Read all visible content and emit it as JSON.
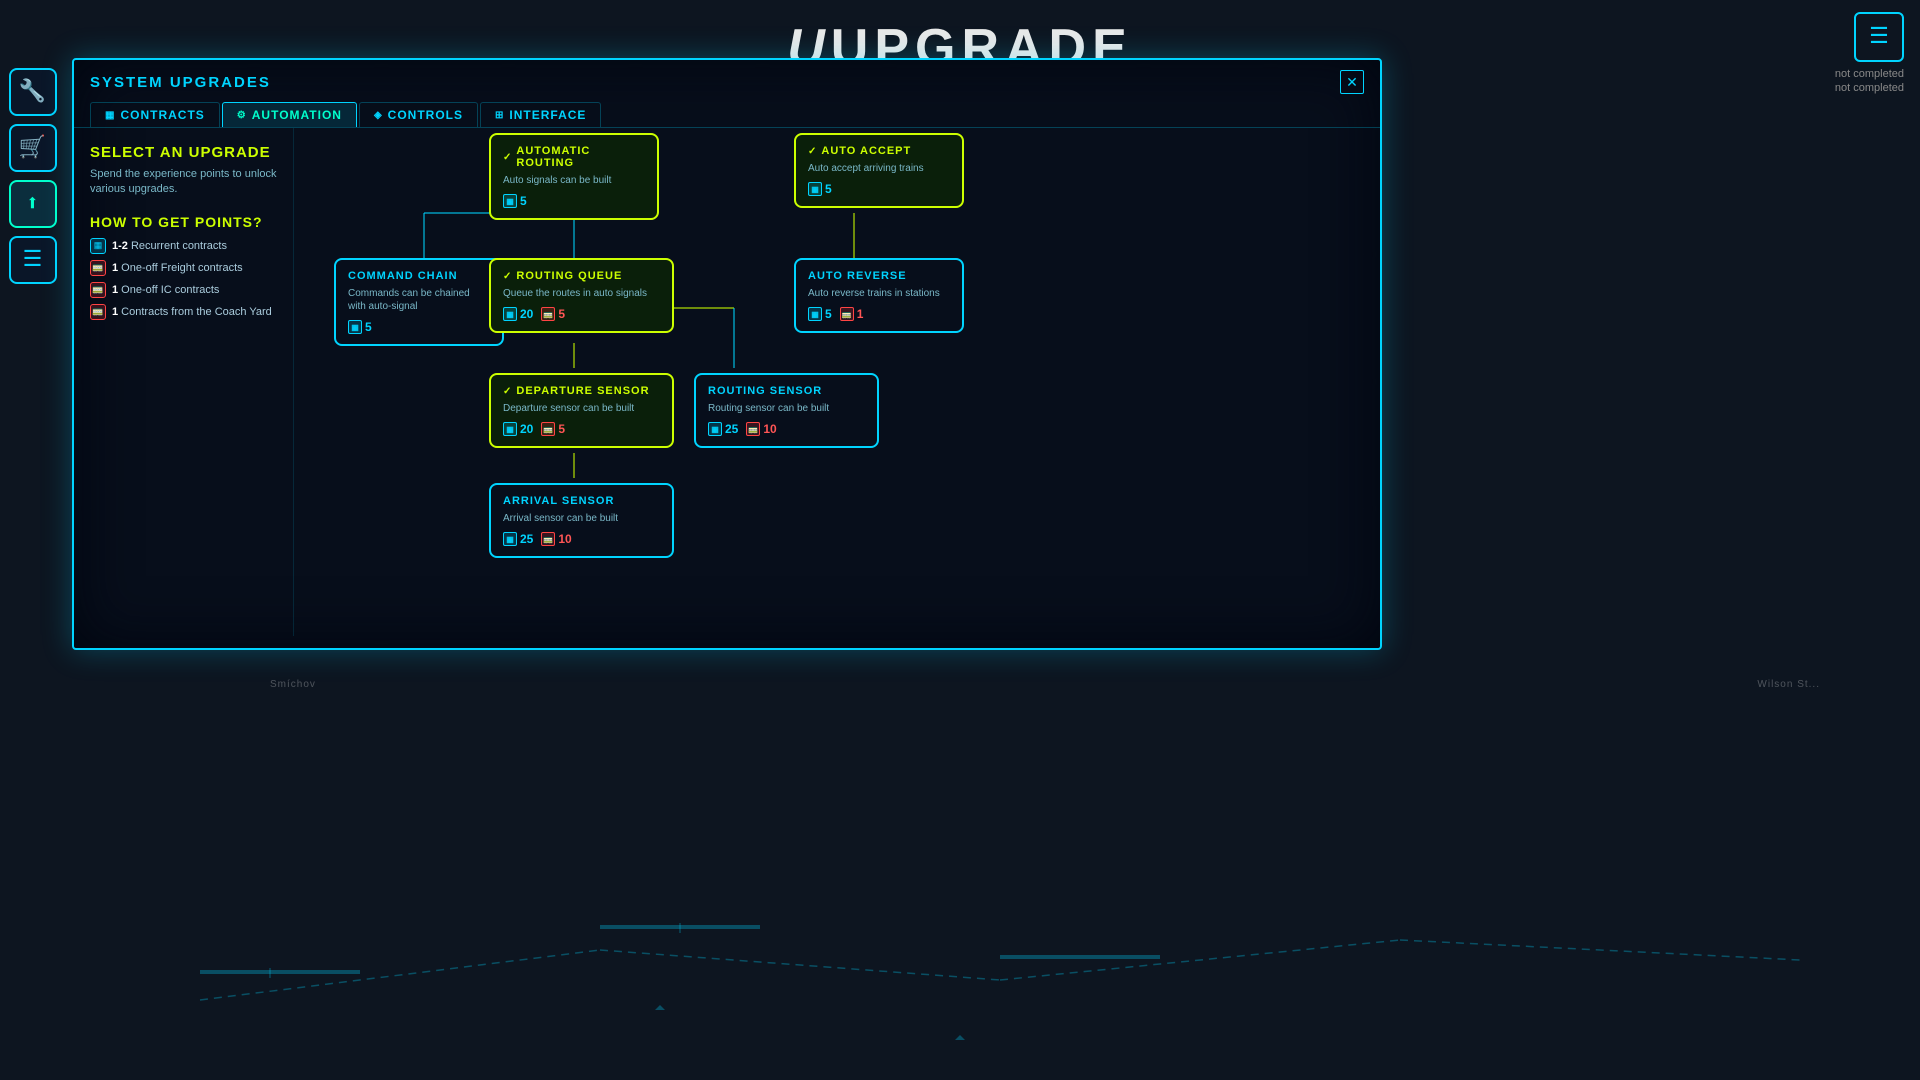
{
  "page": {
    "title": "Upgrade",
    "status1": "not completed",
    "status2": "not completed"
  },
  "sidebar": {
    "buttons": [
      {
        "id": "wrench",
        "icon": "🔧",
        "active": false
      },
      {
        "id": "cart",
        "icon": "🛒",
        "active": false
      },
      {
        "id": "upgrade",
        "icon": "⬆",
        "active": true
      },
      {
        "id": "list",
        "icon": "☰",
        "active": false
      }
    ]
  },
  "dialog": {
    "title": "System Upgrades",
    "close_label": "✕",
    "tabs": [
      {
        "id": "contracts",
        "label": "CONTRACTS",
        "icon": "▦",
        "active": false
      },
      {
        "id": "automation",
        "label": "AUTOMATION",
        "icon": "⚙",
        "active": true
      },
      {
        "id": "controls",
        "label": "CONTROLS",
        "icon": "◈",
        "active": false
      },
      {
        "id": "interface",
        "label": "INTERFACE",
        "icon": "⊞",
        "active": false
      }
    ],
    "left": {
      "select_title": "Select an Upgrade",
      "select_desc": "Spend the experience points to unlock various upgrades.",
      "how_to_title": "How to get points?",
      "points": [
        {
          "icon": "cyan",
          "text": "1-2 Recurrent contracts"
        },
        {
          "icon": "red",
          "text": "1 One-off Freight contracts"
        },
        {
          "icon": "red",
          "text": "1 One-off IC contracts"
        },
        {
          "icon": "red",
          "text": "1 Contracts from the Coach Yard"
        }
      ]
    },
    "upgrades": {
      "automatic_routing": {
        "title": "Automatic Routing",
        "unlocked": true,
        "desc": "Auto signals can be built",
        "costs": [
          {
            "type": "cyan",
            "value": "5"
          }
        ]
      },
      "auto_accept": {
        "title": "Auto Accept",
        "unlocked": true,
        "desc": "Auto accept arriving trains",
        "costs": [
          {
            "type": "cyan",
            "value": "5"
          }
        ]
      },
      "command_chain": {
        "title": "Command Chain",
        "unlocked": false,
        "desc": "Commands can be chained with auto-signal",
        "costs": [
          {
            "type": "cyan",
            "value": "5"
          }
        ]
      },
      "routing_queue": {
        "title": "Routing Queue",
        "unlocked": true,
        "desc": "Queue the routes in auto signals",
        "costs": [
          {
            "type": "cyan",
            "value": "20"
          },
          {
            "type": "red",
            "value": "5"
          }
        ]
      },
      "auto_reverse": {
        "title": "Auto Reverse",
        "unlocked": false,
        "desc": "Auto reverse trains in stations",
        "costs": [
          {
            "type": "cyan",
            "value": "5"
          },
          {
            "type": "red",
            "value": "1"
          }
        ]
      },
      "departure_sensor": {
        "title": "Departure Sensor",
        "unlocked": true,
        "desc": "Departure sensor can be built",
        "costs": [
          {
            "type": "cyan",
            "value": "20"
          },
          {
            "type": "red",
            "value": "5"
          }
        ]
      },
      "routing_sensor": {
        "title": "Routing Sensor",
        "unlocked": false,
        "desc": "Routing sensor can be built",
        "costs": [
          {
            "type": "cyan",
            "value": "25"
          },
          {
            "type": "red",
            "value": "10"
          }
        ]
      },
      "arrival_sensor": {
        "title": "Arrival Sensor",
        "unlocked": false,
        "desc": "Arrival sensor can be built",
        "costs": [
          {
            "type": "cyan",
            "value": "25"
          },
          {
            "type": "red",
            "value": "10"
          }
        ]
      }
    }
  },
  "map": {
    "station1": "Smíchov",
    "station2": "Wilson St..."
  },
  "icons": {
    "check": "✓",
    "train_cyan": "🚃",
    "train_red": "🚃"
  }
}
